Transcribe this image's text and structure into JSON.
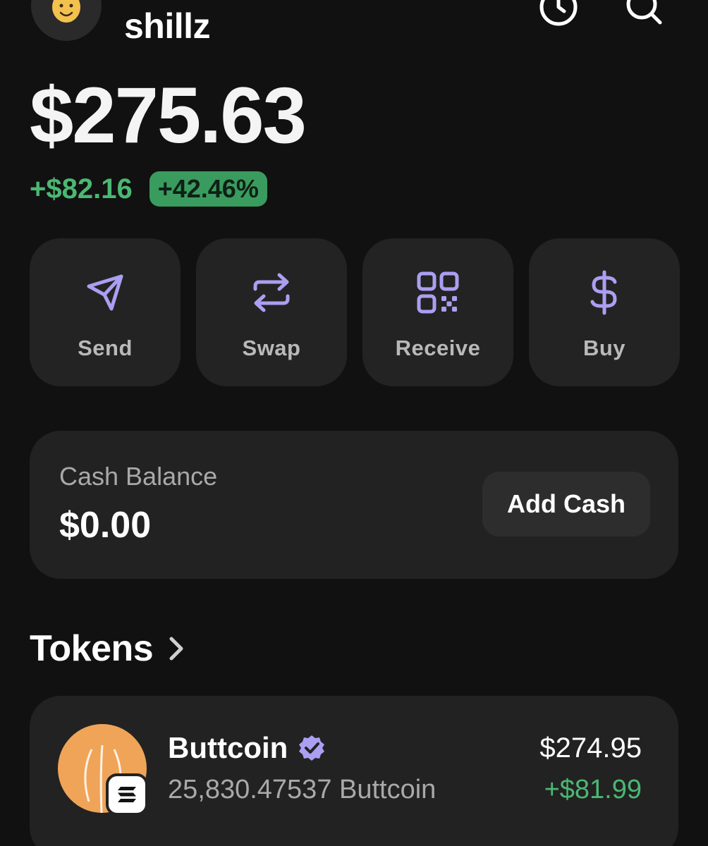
{
  "header": {
    "username": "shillz"
  },
  "balance": {
    "total": "$275.63",
    "change_amount": "+$82.16",
    "change_percent": "+42.46%"
  },
  "actions": [
    {
      "label": "Send",
      "icon": "send-icon"
    },
    {
      "label": "Swap",
      "icon": "swap-icon"
    },
    {
      "label": "Receive",
      "icon": "qr-code-icon"
    },
    {
      "label": "Buy",
      "icon": "dollar-icon"
    }
  ],
  "cash": {
    "label": "Cash Balance",
    "value": "$0.00",
    "button_label": "Add Cash"
  },
  "tokens": {
    "title": "Tokens",
    "items": [
      {
        "name": "Buttcoin",
        "verified": true,
        "amount": "25,830.47537 Buttcoin",
        "value": "$274.95",
        "change": "+$81.99"
      }
    ]
  },
  "colors": {
    "background": "#111111",
    "card": "#222222",
    "accent": "#ab9ff2",
    "positive": "#4bb872",
    "positive_badge": "#3a9b5e"
  }
}
